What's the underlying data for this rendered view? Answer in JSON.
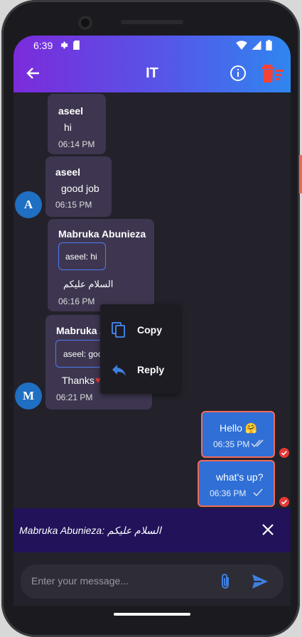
{
  "status_bar": {
    "time": "6:39"
  },
  "app_bar": {
    "title": "IT"
  },
  "messages": [
    {
      "sender": "aseel",
      "text": "hi",
      "time": "06:14 PM"
    },
    {
      "sender": "aseel",
      "text": "good job",
      "time": "06:15 PM",
      "avatar": "A"
    },
    {
      "sender": "Mabruka Abunieza",
      "quote": "aseel: hi",
      "text": "السلام عليكم",
      "time": "06:16 PM"
    },
    {
      "sender": "Mabruka A",
      "quote": "aseel: goo",
      "text": "Thanks",
      "time": "06:21 PM",
      "avatar": "M"
    }
  ],
  "my_messages": [
    {
      "text": "Hello 🤗",
      "time": "06:35 PM"
    },
    {
      "text": "what's up?",
      "time": "06:36 PM"
    }
  ],
  "context_menu": {
    "copy": "Copy",
    "reply": "Reply"
  },
  "reply_preview": {
    "text": "Mabruka Abunieza: السلام عليكم"
  },
  "composer": {
    "placeholder": "Enter your message..."
  },
  "colors": {
    "accent": "#2f6fd6",
    "bubble": "#3e3650",
    "danger": "#e53935"
  }
}
